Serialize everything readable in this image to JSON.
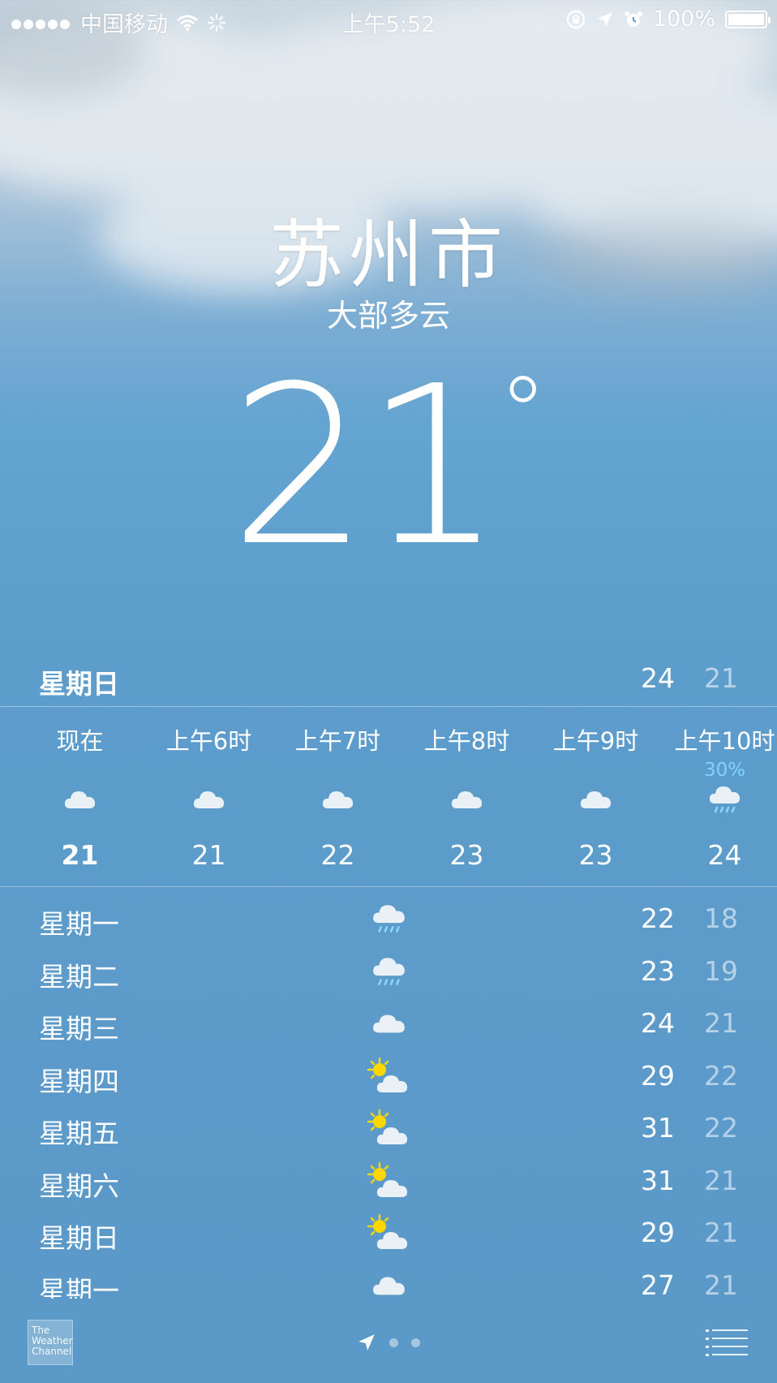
{
  "status_bar": {
    "carrier": "中国移动",
    "time": "上午5:52",
    "battery": "100%",
    "battery_level": 1.0,
    "icons": [
      "signal-dots",
      "wifi-icon",
      "activity-spinner-icon",
      "rotation-lock-icon",
      "location-arrow-icon",
      "alarm-icon",
      "battery-icon"
    ]
  },
  "city": "苏州市",
  "condition": "大部多云",
  "current_temp": "21",
  "degree": "°",
  "today": {
    "day": "星期日",
    "high": "24",
    "low": "21"
  },
  "hourly": [
    {
      "time": "现在",
      "icon": "cloud-icon",
      "temp": "21",
      "precip": ""
    },
    {
      "time": "上午6时",
      "icon": "cloud-icon",
      "temp": "21",
      "precip": ""
    },
    {
      "time": "上午7时",
      "icon": "cloud-icon",
      "temp": "22",
      "precip": ""
    },
    {
      "time": "上午8时",
      "icon": "cloud-icon",
      "temp": "23",
      "precip": ""
    },
    {
      "time": "上午9时",
      "icon": "cloud-icon",
      "temp": "23",
      "precip": ""
    },
    {
      "time": "上午10时",
      "icon": "rain-cloud-icon",
      "temp": "24",
      "precip": "30%"
    }
  ],
  "daily": [
    {
      "day": "星期一",
      "icon": "rain-cloud-icon",
      "high": "22",
      "low": "18"
    },
    {
      "day": "星期二",
      "icon": "rain-cloud-icon",
      "high": "23",
      "low": "19"
    },
    {
      "day": "星期三",
      "icon": "cloud-icon",
      "high": "24",
      "low": "21"
    },
    {
      "day": "星期四",
      "icon": "partly-sunny-icon",
      "high": "29",
      "low": "22"
    },
    {
      "day": "星期五",
      "icon": "partly-sunny-icon",
      "high": "31",
      "low": "22"
    },
    {
      "day": "星期六",
      "icon": "partly-sunny-icon",
      "high": "31",
      "low": "21"
    },
    {
      "day": "星期日",
      "icon": "partly-sunny-icon",
      "high": "29",
      "low": "21"
    },
    {
      "day": "星期一",
      "icon": "cloud-icon",
      "high": "27",
      "low": "21"
    }
  ],
  "toolbar": {
    "logo_text": "The Weather Channel",
    "page_dots": 2,
    "icons": [
      "weather-channel-logo",
      "location-arrow-icon",
      "page-dot",
      "list-icon"
    ]
  },
  "colors": {
    "rain_accent": "#7fd4ff",
    "sun": "#ffd700",
    "sky": "#5d9dcc"
  }
}
